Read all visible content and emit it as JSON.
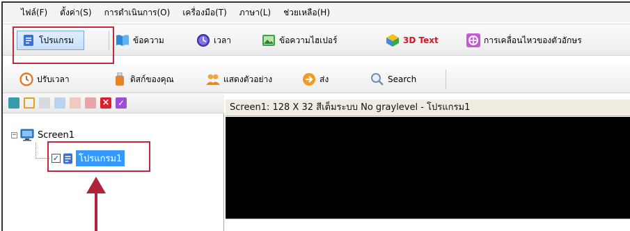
{
  "menubar": {
    "items": [
      "ไฟล์(F)",
      "ตั้งค่า(S)",
      "การดำเนินการ(O)",
      "เครื่องมือ(T)",
      "ภาษา(L)",
      "ช่วยเหลือ(H)"
    ]
  },
  "toolbar1": {
    "program_label": "โปรแกรม",
    "message_label": "ข้อความ",
    "time_label": "เวลา",
    "hypertext_label": "ข้อความไฮเปอร์",
    "text3d_label": "3D Text",
    "animation_label": "การเคลื่อนไหวของตัวอักษร"
  },
  "toolbar2": {
    "adjust_time_label": "ปรับเวลา",
    "your_disk_label": "ดิสก์ของคุณ",
    "preview_label": "แสดงตัวอย่าง",
    "send_label": "ส่ง",
    "search_label": "Search"
  },
  "tree": {
    "root_label": "Screen1",
    "child_label": "โปรแกรม1",
    "expander": "−"
  },
  "screen": {
    "title": "Screen1: 128 X 32  สีเต็มระบบ  No graylevel - โปรแกรม1"
  },
  "colors": {
    "highlight": "#c0283c",
    "arrow": "#b0233a",
    "selection": "#3399ff"
  }
}
